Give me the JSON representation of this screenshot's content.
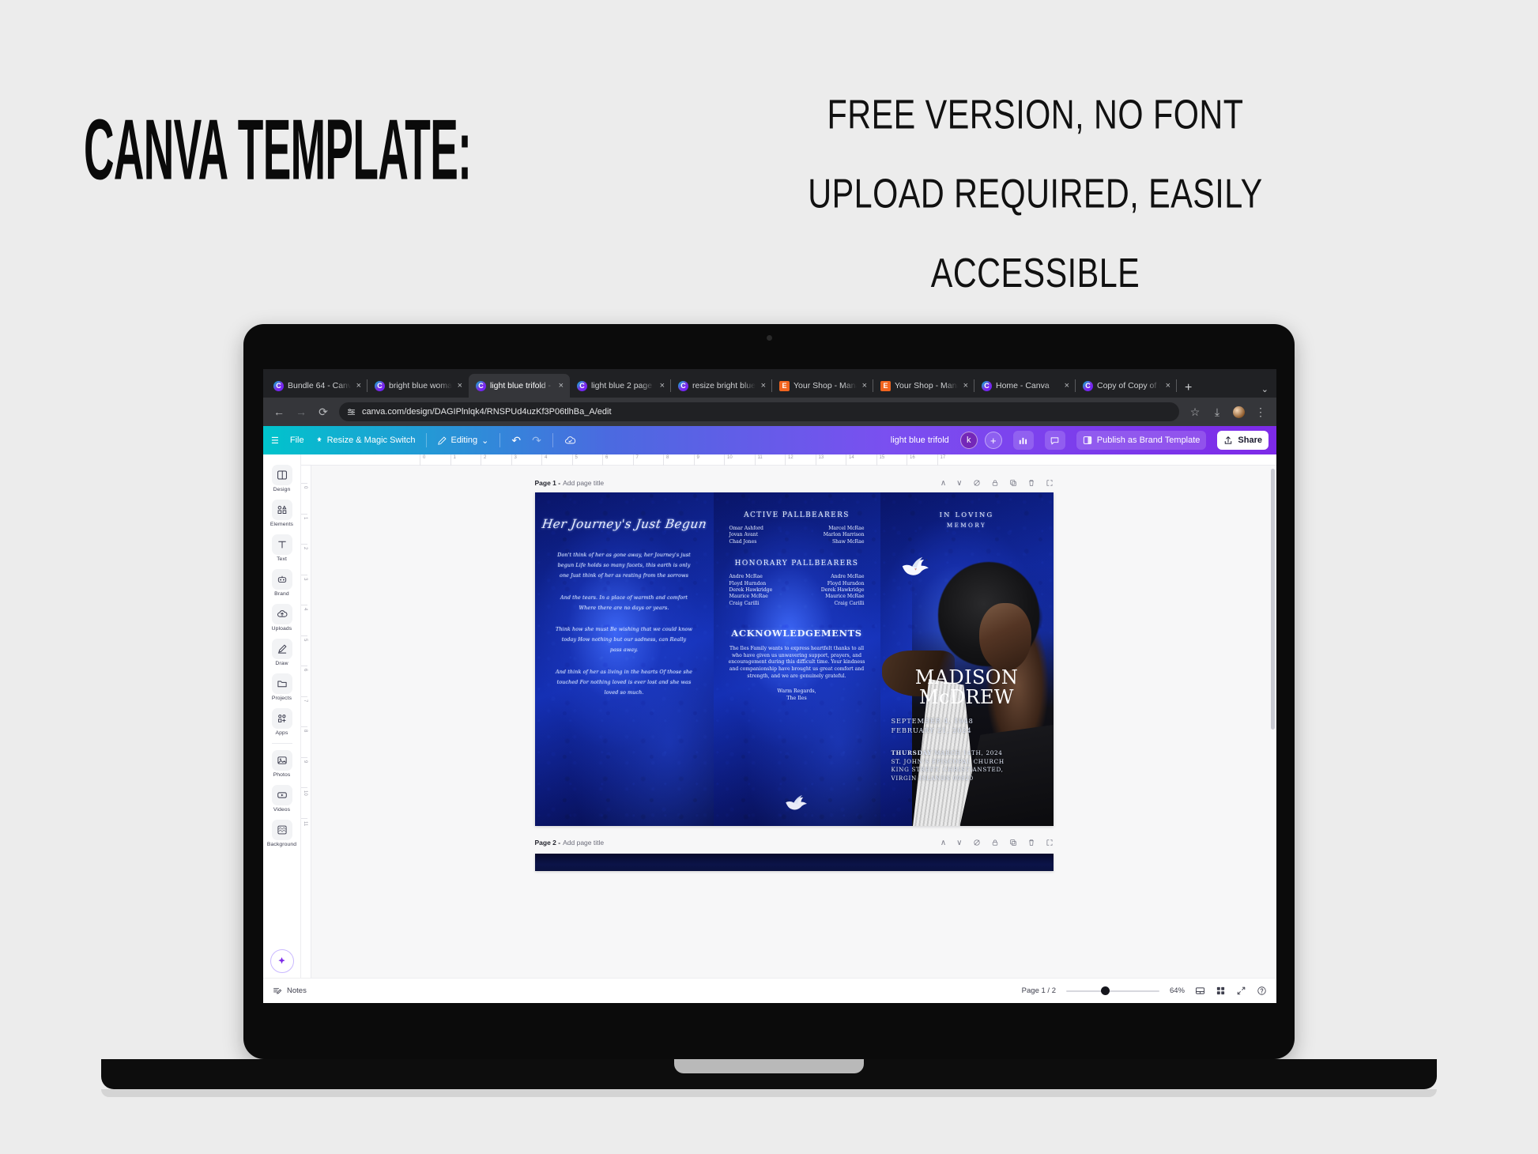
{
  "promo": {
    "headline_left": "CANVA TEMPLATE:",
    "headline_right_line1": "FREE VERSION, NO FONT",
    "headline_right_line2": "UPLOAD REQUIRED, EASILY",
    "headline_right_line3": "ACCESSIBLE"
  },
  "browser": {
    "tabs": [
      {
        "title": "Bundle 64 - Canv",
        "favicon": "canva-icon",
        "active": false
      },
      {
        "title": "bright blue woma",
        "favicon": "canva-icon",
        "active": false
      },
      {
        "title": "light blue trifold -",
        "favicon": "canva-icon",
        "active": true
      },
      {
        "title": "light blue 2 page",
        "favicon": "canva-icon",
        "active": false
      },
      {
        "title": "resize bright blue",
        "favicon": "canva-icon",
        "active": false
      },
      {
        "title": "Your Shop - Mana",
        "favicon": "etsy-icon",
        "active": false
      },
      {
        "title": "Your Shop - Mana",
        "favicon": "etsy-icon",
        "active": false
      },
      {
        "title": "Home - Canva",
        "favicon": "canva-icon",
        "active": false
      },
      {
        "title": "Copy of Copy of E",
        "favicon": "canva-icon",
        "active": false
      }
    ],
    "new_tab_label": "+",
    "tab_close_label": "×",
    "tablist_chevron": "⌄",
    "back_label": "←",
    "forward_label": "→",
    "reload_label": "⟳",
    "url": "canva.com/design/DAGIPlnlqk4/RNSPUd4uzKf3P06tlhBa_A/edit",
    "star_label": "☆",
    "download_label": "⤓",
    "menu_label": "⋮"
  },
  "canva": {
    "toolbar": {
      "menu_label": "☰",
      "file_label": "File",
      "resize_label": "Resize & Magic Switch",
      "editing_label": "Editing",
      "editing_chevron": "⌄",
      "undo_label": "↶",
      "redo_label": "↷",
      "cloud_label": "☁",
      "doc_title": "light blue trifold",
      "avatar_initial": "k",
      "add_people_label": "+",
      "insights_label": "insights-icon",
      "comment_label": "comment-icon",
      "publish_label": "Publish as Brand Template",
      "share_label": "Share"
    },
    "sidebar": [
      {
        "label": "Design",
        "icon": "design-icon"
      },
      {
        "label": "Elements",
        "icon": "elements-icon"
      },
      {
        "label": "Text",
        "icon": "text-icon"
      },
      {
        "label": "Brand",
        "icon": "brand-icon"
      },
      {
        "label": "Uploads",
        "icon": "uploads-icon"
      },
      {
        "label": "Draw",
        "icon": "draw-icon"
      },
      {
        "label": "Projects",
        "icon": "projects-icon"
      },
      {
        "label": "Apps",
        "icon": "apps-icon"
      },
      {
        "label": "Photos",
        "icon": "photos-icon"
      },
      {
        "label": "Videos",
        "icon": "videos-icon"
      },
      {
        "label": "Background",
        "icon": "background-icon"
      }
    ],
    "ruler_h_ticks": [
      "0",
      "1",
      "2",
      "3",
      "4",
      "5",
      "6",
      "7",
      "8",
      "9",
      "10",
      "11",
      "12",
      "13",
      "14",
      "15",
      "16",
      "17"
    ],
    "ruler_v_ticks": [
      "0",
      "1",
      "2",
      "3",
      "4",
      "5",
      "6",
      "7",
      "8",
      "9",
      "10",
      "11"
    ],
    "page1": {
      "label": "Page 1 -",
      "title_placeholder": "Add page title",
      "tools": [
        "∧",
        "∨",
        "◑",
        "⚿",
        "⧉",
        "Ὕ1",
        "⤴"
      ]
    },
    "page2": {
      "label": "Page 2 -",
      "title_placeholder": "Add page title"
    },
    "statusbar": {
      "notes_label": "Notes",
      "page_indicator": "Page 1 / 2",
      "zoom_level": "64%",
      "grid_view_label": "grid-view-icon",
      "pages_view_label": "pages-view-icon",
      "fullscreen_label": "fullscreen-icon",
      "help_label": "?"
    }
  },
  "design": {
    "left_panel": {
      "title": "Her Journey's Just Begun",
      "stanzas": [
        "Don't think of her as gone away, her Journey's just begun Life holds so many facets, this earth is only one Just think of her as resting from the sorrows",
        "And the tears. In a place of warmth and comfort Where there are no days or years.",
        "Think how she must Be wishing that we could know today How nothing but our sadness, can Really pass away.",
        "And think of her as living in the hearts Of those she touched For nothing loved is ever lost and she was loved so much."
      ]
    },
    "mid_panel": {
      "active_heading": "ACTIVE PALLBEARERS",
      "active_left": [
        "Omar Ashford",
        "Jovan Avant",
        "Chad Jones"
      ],
      "active_right": [
        "Marcel McRae",
        "Marlon Harrison",
        "Shaw McRae"
      ],
      "honorary_heading": "HONORARY PALLBEARERS",
      "honorary_left": [
        "Andre McRae",
        "Floyd Hurndon",
        "Derek Hawkridge",
        "Maurice McRae",
        "Craig Carilli"
      ],
      "honorary_right": [
        "Andre McRae",
        "Floyd Hurndon",
        "Derek Hawkridge",
        "Maurice McRae",
        "Craig Carilli"
      ],
      "ack_heading": "ACKNOWLEDGEMENTS",
      "ack_body": "The Iles Family wants to express heartfelt thanks to all who have given us unwavering support, prayers, and encouragement during this difficult time. Your kindness and companionship have brought us great comfort and strength, and we are genuinely grateful.",
      "regards_line1": "Warm Regards,",
      "regards_line2": "The Iles"
    },
    "right_panel": {
      "in_loving": "IN LOVING",
      "memory": "MEMORY",
      "name_line1": "MADISON",
      "name_line2": "McDREW",
      "date_born": "SEPTEMBER 4, 1948",
      "date_died": "FEBRUARY 21, 2024",
      "service_day": "THURSDAY",
      "service_date": "MARCH 14TH, 2024",
      "service_venue": "ST. JOHN'S EPISCOPAL CHURCH",
      "service_street": "KING STREET, CHRISTIANSTED,",
      "service_region": "VIRGIN ISLANDS 00820"
    }
  },
  "colors": {
    "canva_purple": "#7d2ae8",
    "canva_teal": "#00c4cc",
    "page_bg": "#ececec",
    "chrome_dark": "#202124"
  }
}
